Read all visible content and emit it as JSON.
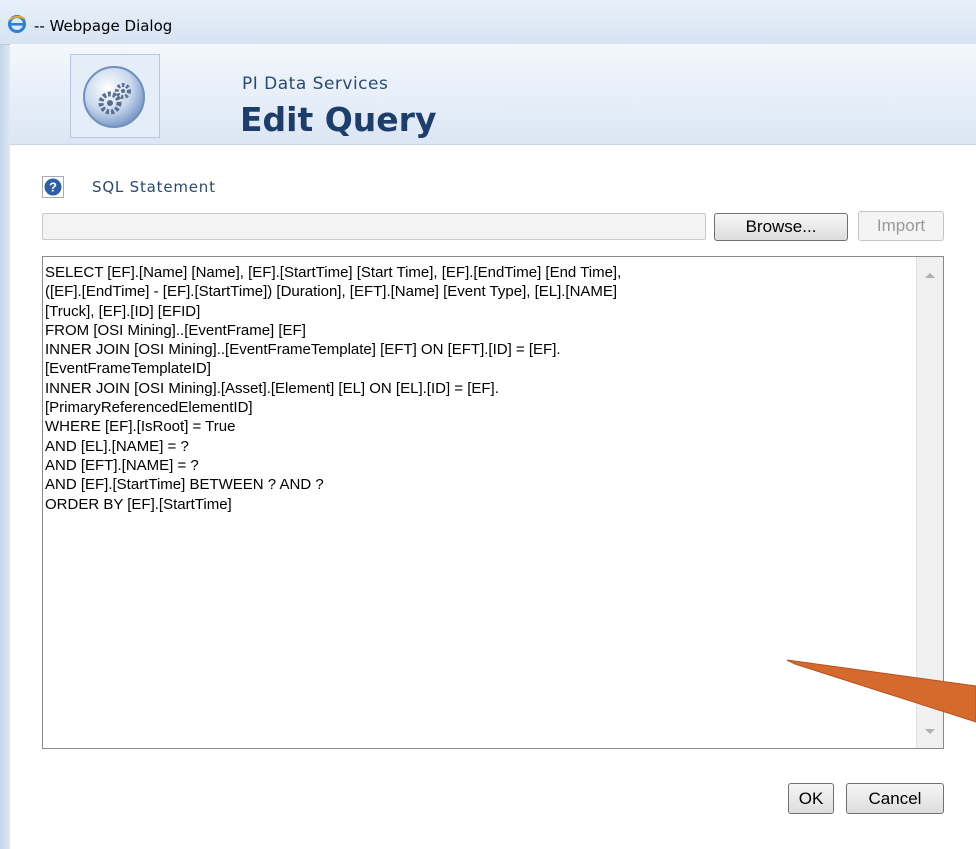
{
  "window": {
    "title": "-- Webpage Dialog",
    "icon": "ie-icon"
  },
  "header": {
    "subtitle": "PI Data Services",
    "title": "Edit Query",
    "logo_icon": "gears-icon"
  },
  "section": {
    "label": "SQL Statement",
    "help_icon": "help-icon"
  },
  "file": {
    "value": "",
    "browse_label": "Browse...",
    "import_label": "Import"
  },
  "sql": {
    "statement": "SELECT [EF].[Name] [Name], [EF].[StartTime] [Start Time], [EF].[EndTime] [End Time],\n([EF].[EndTime] - [EF].[StartTime]) [Duration], [EFT].[Name] [Event Type], [EL].[NAME]\n[Truck], [EF].[ID] [EFID]\nFROM [OSI Mining]..[EventFrame] [EF]\nINNER JOIN [OSI Mining]..[EventFrameTemplate] [EFT] ON [EFT].[ID] = [EF].\n[EventFrameTemplateID]\nINNER JOIN [OSI Mining].[Asset].[Element] [EL] ON [EL].[ID] = [EF].\n[PrimaryReferencedElementID]\nWHERE [EF].[IsRoot] = True\nAND [EL].[NAME] = ?\nAND [EFT].[NAME] = ?\nAND [EF].[StartTime] BETWEEN ? AND ?\nORDER BY [EF].[StartTime]"
  },
  "actions": {
    "ok_label": "OK",
    "cancel_label": "Cancel"
  },
  "colors": {
    "title_accent": "#1d3d6b",
    "annotation_arrow": "#d46a2e"
  }
}
